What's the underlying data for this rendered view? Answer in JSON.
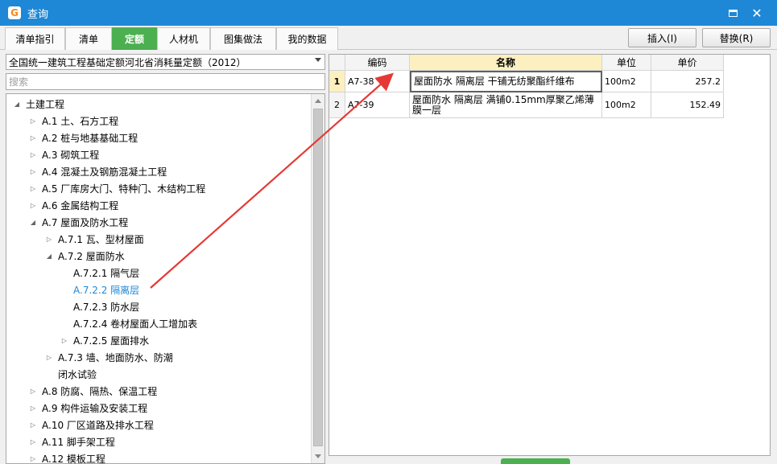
{
  "window": {
    "title": "查询",
    "logo_glyph": "G"
  },
  "tabs": [
    "清单指引",
    "清单",
    "定额",
    "人材机",
    "图集做法",
    "我的数据"
  ],
  "active_tab_index": 2,
  "actions": {
    "insert": "插入(I)",
    "replace": "替换(R)"
  },
  "dropdown": {
    "selected": "全国统一建筑工程基础定额河北省消耗量定额（2012）"
  },
  "search": {
    "placeholder": "搜索"
  },
  "tree": [
    {
      "label": "土建工程",
      "level": 0,
      "expanded": true
    },
    {
      "label": "A.1 土、石方工程",
      "level": 1,
      "expanded": false
    },
    {
      "label": "A.2 桩与地基基础工程",
      "level": 1,
      "expanded": false
    },
    {
      "label": "A.3 砌筑工程",
      "level": 1,
      "expanded": false
    },
    {
      "label": "A.4 混凝土及钢筋混凝土工程",
      "level": 1,
      "expanded": false
    },
    {
      "label": "A.5 厂库房大门、特种门、木结构工程",
      "level": 1,
      "expanded": false
    },
    {
      "label": "A.6 金属结构工程",
      "level": 1,
      "expanded": false
    },
    {
      "label": "A.7 屋面及防水工程",
      "level": 1,
      "expanded": true
    },
    {
      "label": "A.7.1 瓦、型材屋面",
      "level": 2,
      "expanded": false
    },
    {
      "label": "A.7.2 屋面防水",
      "level": 2,
      "expanded": true
    },
    {
      "label": "A.7.2.1 隔气层",
      "level": 3,
      "leaf": true
    },
    {
      "label": "A.7.2.2 隔离层",
      "level": 3,
      "leaf": true,
      "selected": true
    },
    {
      "label": "A.7.2.3 防水层",
      "level": 3,
      "leaf": true
    },
    {
      "label": "A.7.2.4 卷材屋面人工增加表",
      "level": 3,
      "leaf": true
    },
    {
      "label": "A.7.2.5 屋面排水",
      "level": 3,
      "expanded": false
    },
    {
      "label": "A.7.3 墙、地面防水、防潮",
      "level": 2,
      "expanded": false
    },
    {
      "label": "闭水试验",
      "level": 2,
      "leaf": true
    },
    {
      "label": "A.8 防腐、隔热、保温工程",
      "level": 1,
      "expanded": false
    },
    {
      "label": "A.9 构件运输及安装工程",
      "level": 1,
      "expanded": false
    },
    {
      "label": "A.10 厂区道路及排水工程",
      "level": 1,
      "expanded": false
    },
    {
      "label": "A.11 脚手架工程",
      "level": 1,
      "expanded": false
    },
    {
      "label": "A.12 模板工程",
      "level": 1,
      "expanded": false
    }
  ],
  "grid": {
    "headers": {
      "code": "编码",
      "name": "名称",
      "unit": "单位",
      "price": "单价"
    },
    "rows": [
      {
        "num": "1",
        "code": "A7-38",
        "name": "屋面防水 隔离层 干铺无纺聚酯纤维布",
        "unit": "100m2",
        "price": "257.2"
      },
      {
        "num": "2",
        "code": "A7-39",
        "name": "屋面防水 隔离层 满铺0.15mm厚聚乙烯薄膜一层",
        "unit": "100m2",
        "price": "152.49"
      }
    ]
  },
  "colors": {
    "titlebar": "#1e88d6",
    "active_tab": "#4caf50",
    "arrow": "#e53935",
    "selected_text": "#1e88d6"
  }
}
